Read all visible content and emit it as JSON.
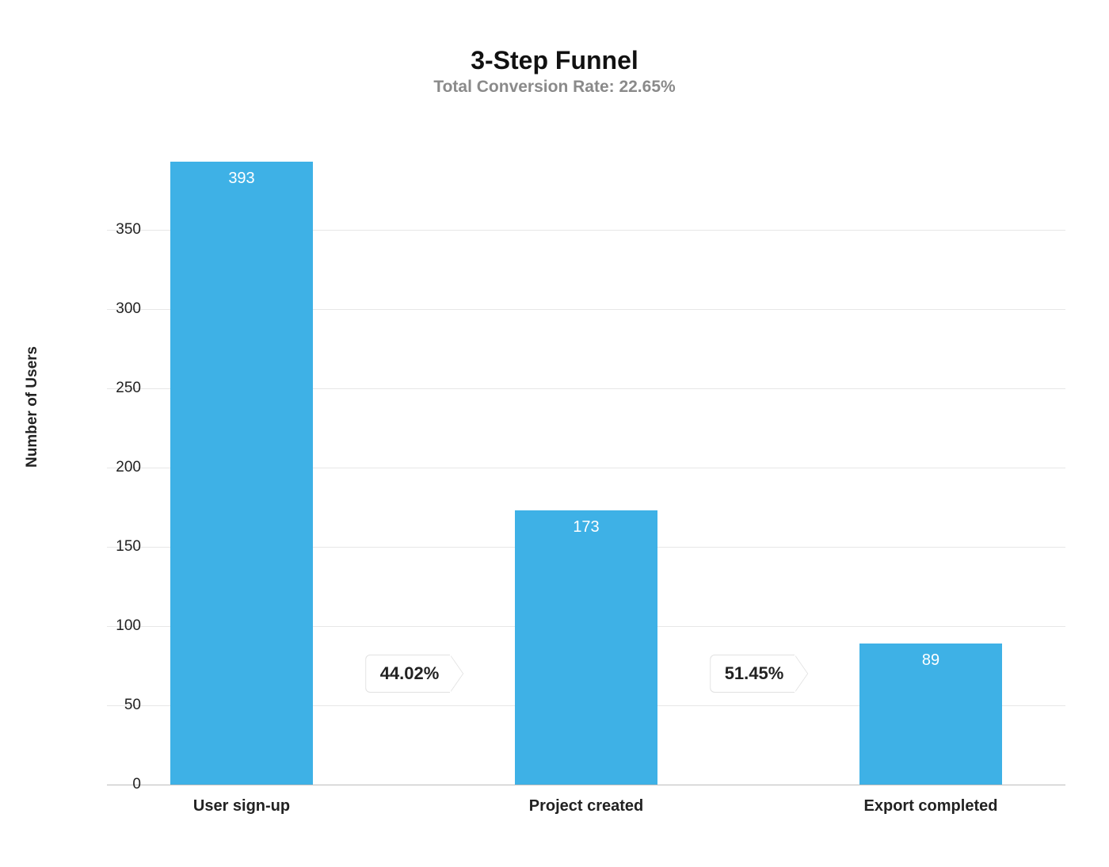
{
  "chart_data": {
    "type": "bar",
    "title": "3-Step Funnel",
    "subtitle": "Total Conversion Rate: 22.65%",
    "ylabel": "Number of Users",
    "xlabel": "",
    "ylim": [
      0,
      400
    ],
    "yticks": [
      0,
      50,
      100,
      150,
      200,
      250,
      300,
      350
    ],
    "categories": [
      "User sign-up",
      "Project created",
      "Export completed"
    ],
    "values": [
      393,
      173,
      89
    ],
    "step_conversions": [
      "44.02%",
      "51.45%"
    ],
    "bar_color": "#3eb1e6"
  }
}
